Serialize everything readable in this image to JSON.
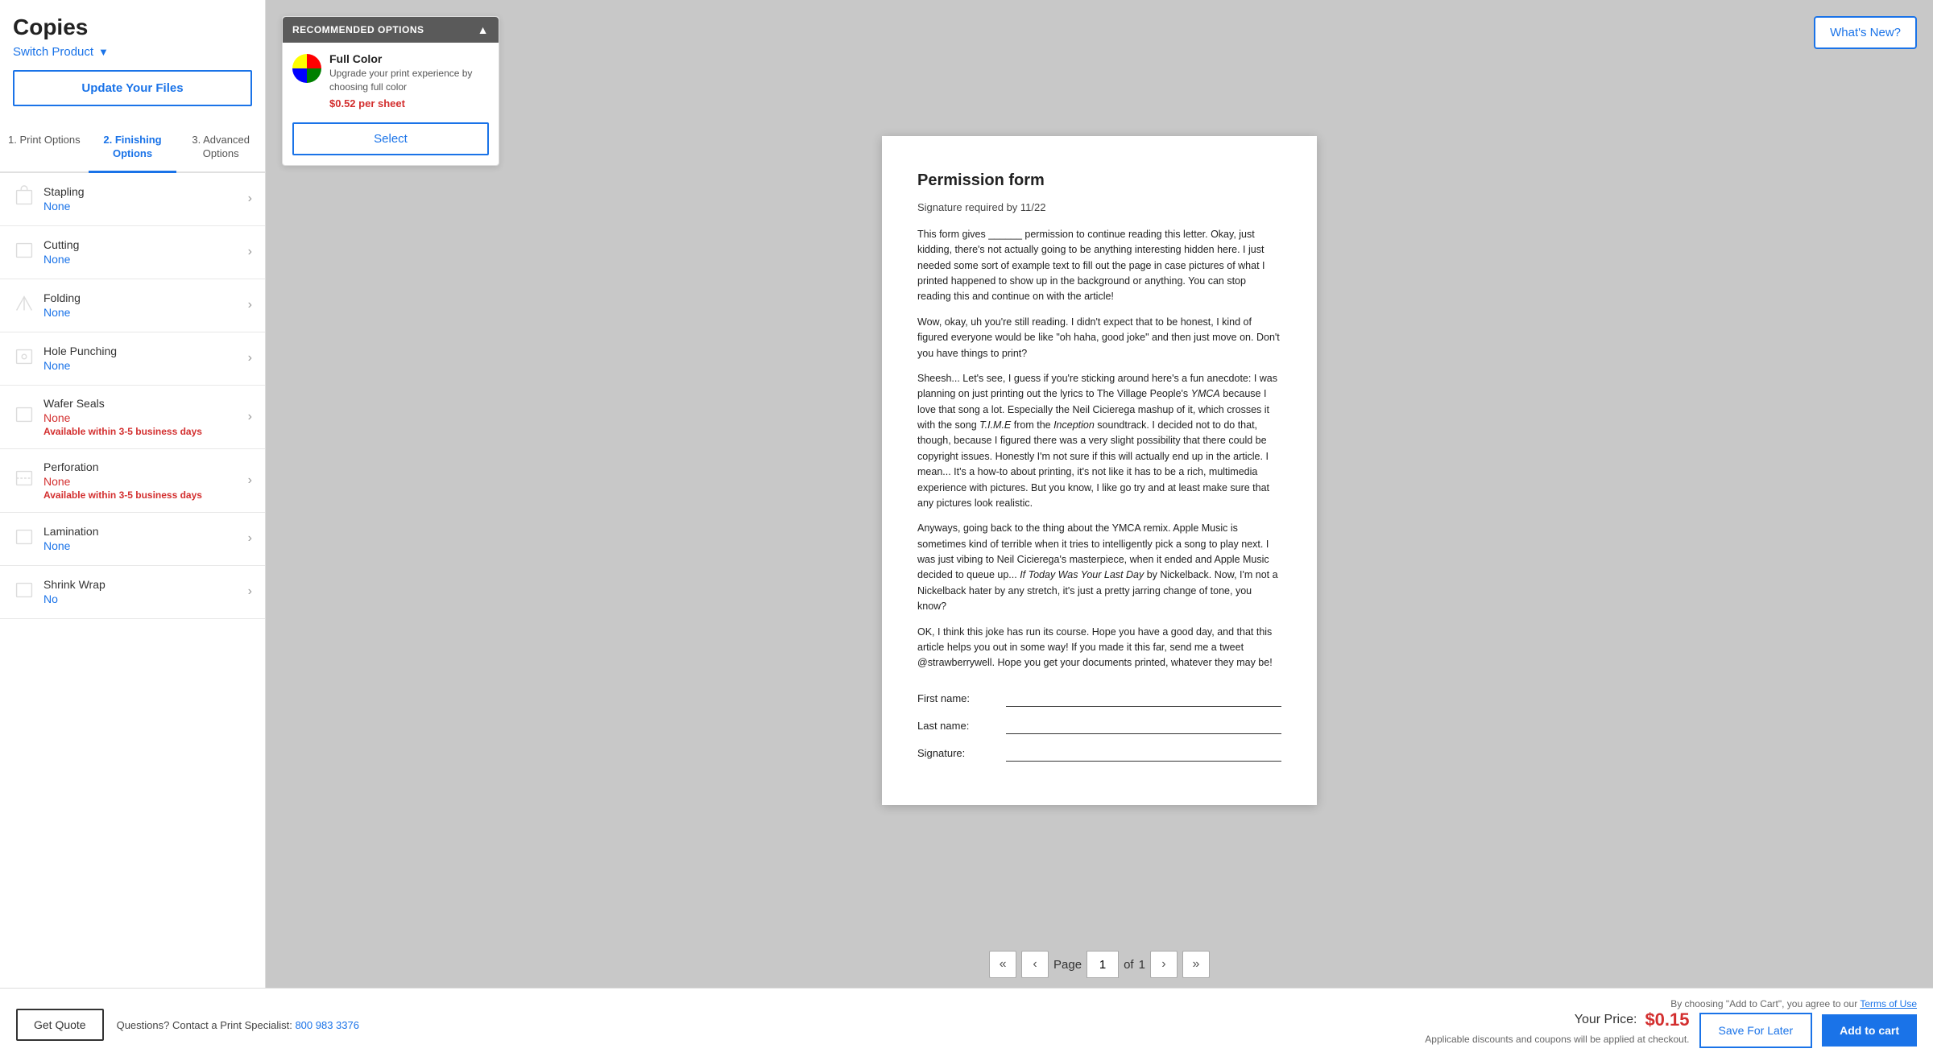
{
  "sidebar": {
    "title": "Copies",
    "switch_product_label": "Switch Product",
    "update_files_label": "Update Your Files",
    "tabs": [
      {
        "id": "print",
        "label": "1. Print Options"
      },
      {
        "id": "finishing",
        "label": "2. Finishing Options"
      },
      {
        "id": "advanced",
        "label": "3. Advanced Options"
      }
    ],
    "active_tab": "finishing",
    "options": [
      {
        "id": "stapling",
        "label": "Stapling",
        "value": "None",
        "available": "",
        "value_color": "blue"
      },
      {
        "id": "cutting",
        "label": "Cutting",
        "value": "None",
        "available": "",
        "value_color": "blue"
      },
      {
        "id": "folding",
        "label": "Folding",
        "value": "None",
        "available": "",
        "value_color": "blue"
      },
      {
        "id": "hole-punching",
        "label": "Hole Punching",
        "value": "None",
        "available": "",
        "value_color": "blue"
      },
      {
        "id": "wafer-seals",
        "label": "Wafer Seals",
        "value": "None",
        "available": "Available within 3-5 business days",
        "value_color": "red"
      },
      {
        "id": "perforation",
        "label": "Perforation",
        "value": "None",
        "available": "Available within 3-5 business days",
        "value_color": "red"
      },
      {
        "id": "lamination",
        "label": "Lamination",
        "value": "None",
        "available": "",
        "value_color": "blue"
      },
      {
        "id": "shrink-wrap",
        "label": "Shrink Wrap",
        "value": "No",
        "available": "",
        "value_color": "blue"
      }
    ]
  },
  "rec_panel": {
    "header": "RECOMMENDED OPTIONS",
    "item_title": "Full Color",
    "item_desc": "Upgrade your print experience by choosing full color",
    "item_price": "$0.52 per sheet",
    "select_label": "Select"
  },
  "whats_new_label": "What's New?",
  "document": {
    "title": "Permission form",
    "subtitle": "Signature required by 11/22",
    "paragraphs": [
      "This form gives ______ permission to continue reading this letter. Okay, just kidding, there's not actually going to be anything interesting hidden here. I just needed some sort of example text to fill out the page in case pictures of what I printed happened to show up in the background or anything. You can stop reading this and continue on with the article!",
      "Wow, okay, uh you're still reading. I didn't expect that to be honest, I kind of figured everyone would be like \"oh haha, good joke\" and then just move on. Don't you have things to print?",
      "Sheesh... Let's see, I guess if you're sticking around here's a fun anecdote: I was planning on just printing out the lyrics to The Village People's YMCA because I love that song a lot. Especially the Neil Cicierega mashup of it, which crosses it with the song T.I.M.E from the Inception soundtrack. I decided not to do that, though, because I figured there was a very slight possibility that there could be copyright issues. Honestly I'm not sure if this will actually end up in the article. I mean... It's a how-to about printing, it's not like it has to be a rich, multimedia experience with pictures. But you know, I like go try and at least make sure that any pictures look realistic.",
      "Anyways, going back to the thing about the YMCA remix. Apple Music is sometimes kind of terrible when it tries to intelligently pick a song to play next. I was just vibing to Neil Cicierega's masterpiece, when it ended and Apple Music decided to queue up... If Today Was Your Last Day by Nickelback. Now, I'm not a Nickelback hater by any stretch, it's just a pretty jarring change of tone, you know?",
      "OK, I think this joke has run its course. Hope you have a good day, and that this article helps you out in some way! If you made it this far, send me a tweet @strawberrywell. Hope you get your documents printed, whatever they may be!"
    ],
    "form_fields": [
      {
        "label": "First name:"
      },
      {
        "label": "Last name:"
      },
      {
        "label": "Signature:"
      }
    ]
  },
  "pagination": {
    "page_label": "Page",
    "current_page": "1",
    "of_label": "of",
    "total_pages": "1"
  },
  "footer": {
    "get_quote_label": "Get Quote",
    "contact_text": "Questions? Contact a Print Specialist:",
    "contact_phone": "800 983 3376",
    "terms_prefix": "By choosing \"Add to Cart\", you agree to our",
    "terms_link": "Terms of Use",
    "your_price_label": "Your Price:",
    "price_value": "$0.15",
    "disclaimer": "Applicable discounts and coupons will be applied at checkout.",
    "save_later_label": "Save For Later",
    "add_to_cart_label": "Add to cart"
  }
}
